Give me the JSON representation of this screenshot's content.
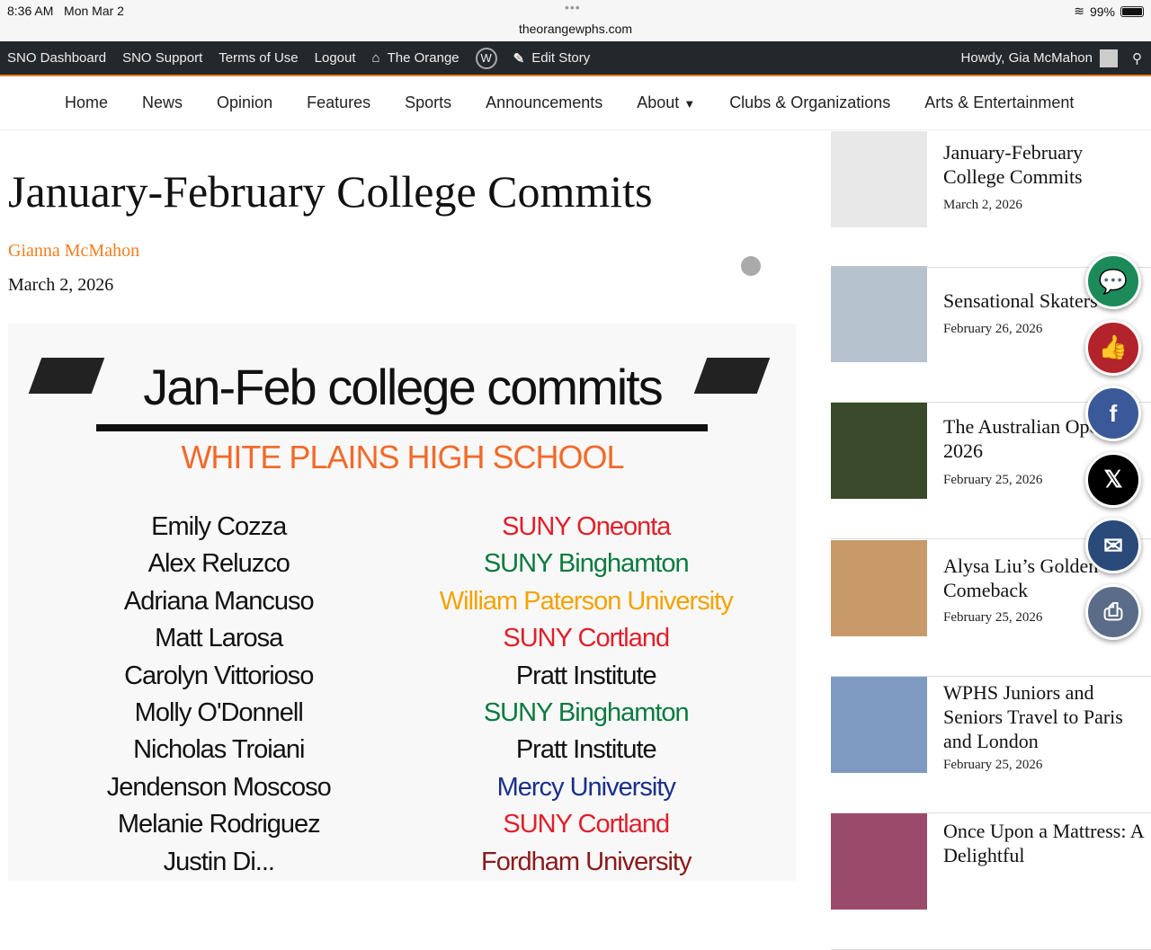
{
  "status": {
    "time": "8:36 AM",
    "date": "Mon Mar 2",
    "url": "theorangewphs.com",
    "battery": "99%",
    "battery_level": 0.99
  },
  "admin": {
    "items": [
      "SNO Dashboard",
      "SNO Support",
      "Terms of Use",
      "Logout",
      "The Orange",
      "Edit Story"
    ],
    "greeting": "Howdy, Gia McMahon"
  },
  "nav": [
    "Home",
    "News",
    "Opinion",
    "Features",
    "Sports",
    "Announcements",
    "About",
    "Clubs & Organizations",
    "Arts & Entertainment"
  ],
  "article": {
    "title": "January-February College Commits",
    "author": "Gianna McMahon",
    "date": "March 2, 2026",
    "graphic": {
      "title": "Jan-Feb college commits",
      "subtitle": "WHITE PLAINS HIGH SCHOOL",
      "rows": [
        {
          "name": "Emily Cozza",
          "school": "SUNY Oneonta",
          "color": "#e0202a"
        },
        {
          "name": "Alex Reluzco",
          "school": "SUNY Binghamton",
          "color": "#0a7a3e"
        },
        {
          "name": "Adriana Mancuso",
          "school": "William Paterson University",
          "color": "#f5a200"
        },
        {
          "name": "Matt Larosa",
          "school": "SUNY Cortland",
          "color": "#e0202a"
        },
        {
          "name": "Carolyn Vittorioso",
          "school": "Pratt Institute",
          "color": "#111111"
        },
        {
          "name": "Molly O'Donnell",
          "school": "SUNY Binghamton",
          "color": "#0a7a3e"
        },
        {
          "name": "Nicholas Troiani",
          "school": "Pratt Institute",
          "color": "#111111"
        },
        {
          "name": "Jendenson Moscoso",
          "school": "Mercy University",
          "color": "#1a2f8a"
        },
        {
          "name": "Melanie Rodriguez",
          "school": "SUNY Cortland",
          "color": "#e0202a"
        },
        {
          "name": "Justin Di...",
          "school": "Fordham University",
          "color": "#8b1a1a"
        }
      ]
    }
  },
  "sidebar": [
    {
      "title": "January-February College Commits",
      "date": "March 2, 2026"
    },
    {
      "title": "Sensational Skaters",
      "date": "February 26, 2026"
    },
    {
      "title": "The Australian Open 2026",
      "date": "February 25, 2026"
    },
    {
      "title": "Alysa Liu’s Golden Comeback",
      "date": "February 25, 2026"
    },
    {
      "title": "WPHS Juniors and Seniors Travel to Paris and London",
      "date": "February 25, 2026"
    },
    {
      "title": "Once Upon a Mattress: A Delightful",
      "date": ""
    }
  ],
  "share": [
    {
      "icon": "comment-icon",
      "color": "#1d8a5a"
    },
    {
      "icon": "thumbs-up-icon",
      "color": "#b3232b"
    },
    {
      "icon": "facebook-icon",
      "color": "#3b5998"
    },
    {
      "icon": "x-icon",
      "color": "#000000"
    },
    {
      "icon": "email-icon",
      "color": "#2a4a7a"
    },
    {
      "icon": "print-icon",
      "color": "#5a6c88"
    }
  ]
}
